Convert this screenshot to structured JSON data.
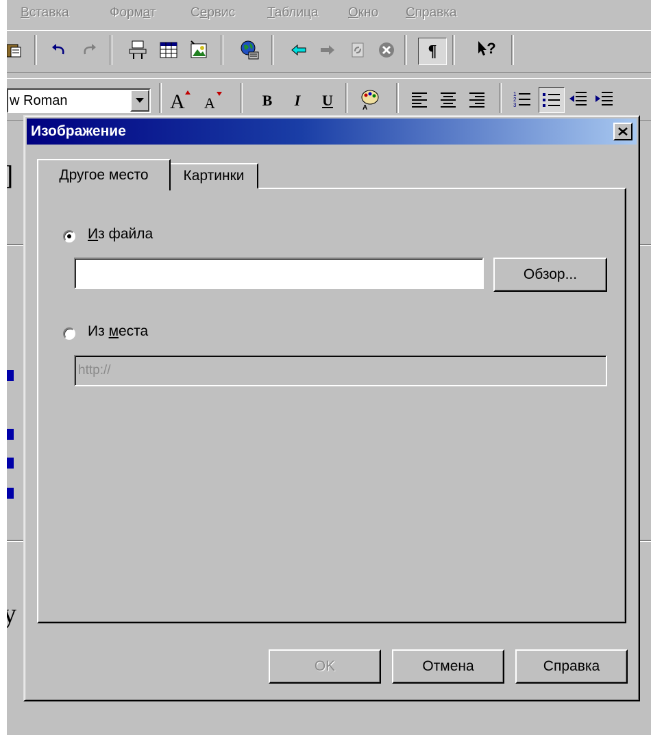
{
  "menu": [
    {
      "label": "Вставка",
      "underline_index": 0
    },
    {
      "label": "Формат",
      "underline_index": 4
    },
    {
      "label": "Сервис",
      "underline_index": 1
    },
    {
      "label": "Таблица",
      "underline_index": 0
    },
    {
      "label": "Окно",
      "underline_index": 0
    },
    {
      "label": "Справка",
      "underline_index": 0
    }
  ],
  "toolbar": {
    "font_value": "w Roman",
    "icons": [
      "paste-icon",
      "undo-icon",
      "redo-icon",
      "insert-table-icon",
      "table-grid-icon",
      "insert-image-icon",
      "web-globe-icon",
      "back-icon",
      "forward-icon",
      "refresh-icon",
      "stop-icon",
      "show-formatting-icon",
      "whats-this-icon",
      "font-grow-icon",
      "font-shrink-icon",
      "bold-icon",
      "italic-icon",
      "underline-icon",
      "text-color-icon",
      "align-left-icon",
      "align-center-icon",
      "align-right-icon",
      "numbered-list-icon",
      "bulleted-list-icon",
      "decrease-indent-icon",
      "increase-indent-icon"
    ],
    "bold": "B",
    "italic": "I",
    "underline": "U",
    "pilcrow": "¶",
    "whats_this": "?"
  },
  "background_doc": {
    "fragment_1": "]",
    "fragment_2": "у"
  },
  "dialog": {
    "title": "Изображение",
    "tabs": [
      {
        "label": "Другое место",
        "active": true
      },
      {
        "label": "Картинки",
        "active": false
      }
    ],
    "from_file": {
      "label": "Из файла",
      "checked": true,
      "value": ""
    },
    "browse_button": "Обзор...",
    "from_url": {
      "label": "Из места",
      "checked": false,
      "value": "http://"
    },
    "buttons": {
      "ok": "OK",
      "cancel": "Отмена",
      "help": "Справка"
    }
  },
  "colors": {
    "face": "#c0c0c0",
    "title_start": "#000080",
    "title_end": "#a8c8f0",
    "link": "#0000a8"
  }
}
